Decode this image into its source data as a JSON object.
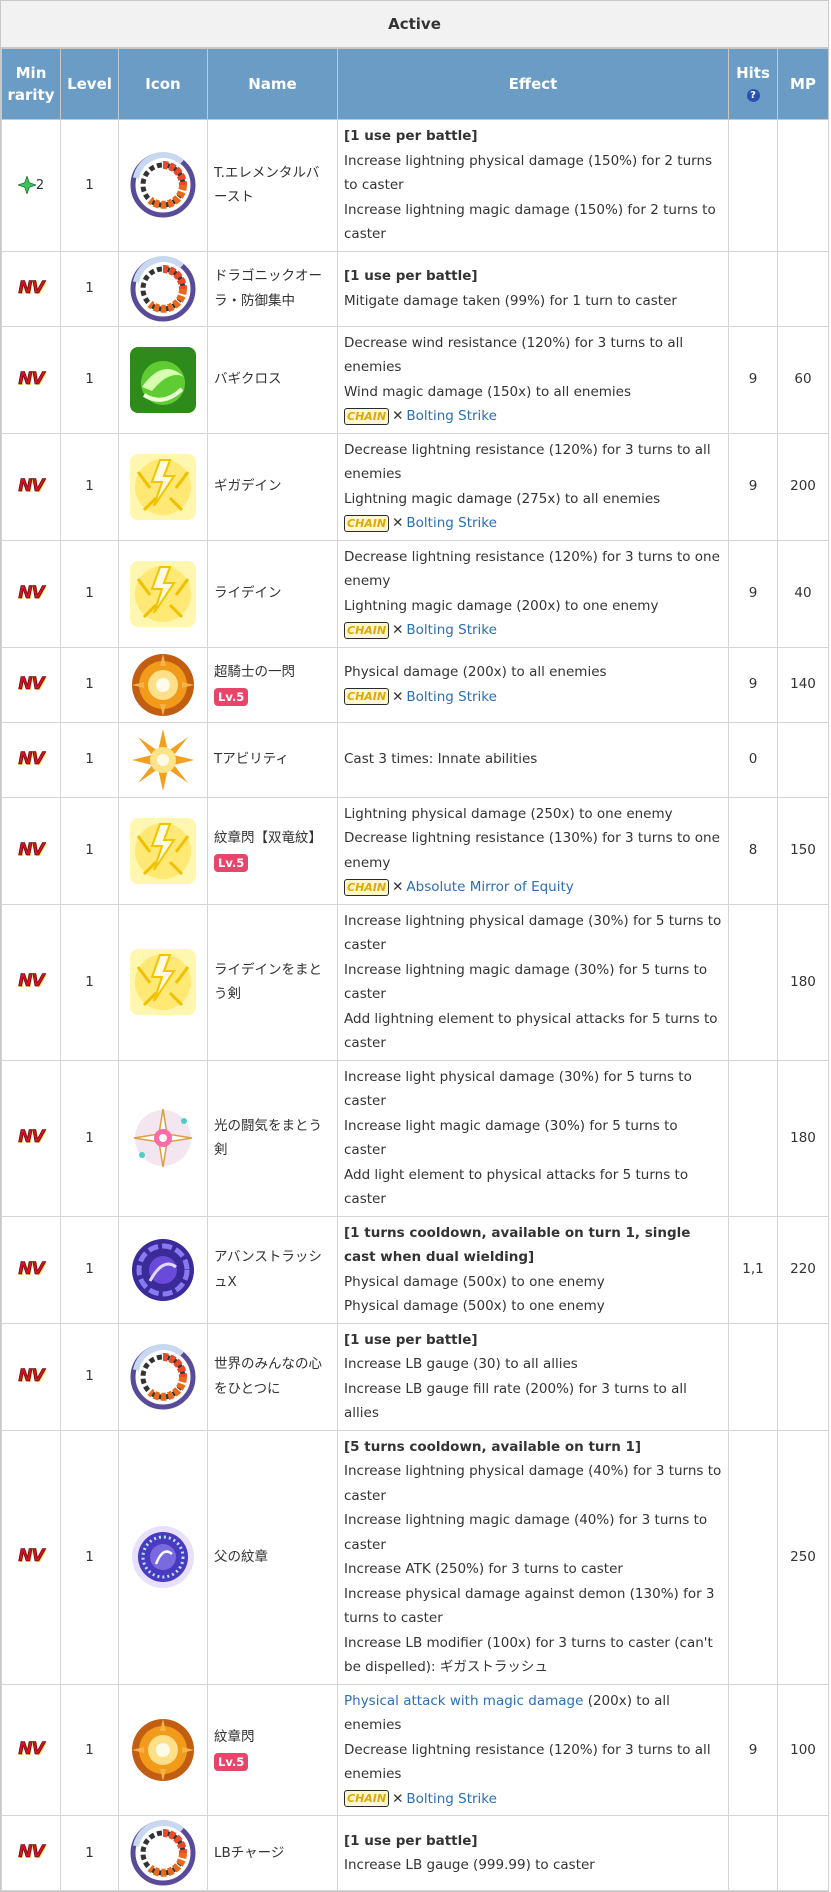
{
  "caption": "Active",
  "headers": {
    "min_rarity": "Min rarity",
    "level": "Level",
    "icon": "Icon",
    "name": "Name",
    "effect": "Effect",
    "hits": "Hits",
    "hits_help": "?",
    "mp": "MP"
  },
  "chain_label": "CHAIN",
  "chain_sep": "✕",
  "rows": [
    {
      "rarity": "2",
      "rarity_type": "star",
      "level": "1",
      "icon": "gauge-icon",
      "name": "T.エレメンタルバースト",
      "lv": "",
      "effects": [
        {
          "text": "[1 use per battle]",
          "bold": true
        },
        {
          "text": "Increase lightning physical damage (150%) for 2 turns to caster"
        },
        {
          "text": "Increase lightning magic damage (150%) for 2 turns to caster"
        }
      ],
      "chain": "",
      "hits": "",
      "mp": ""
    },
    {
      "rarity": "NV",
      "rarity_type": "nv",
      "level": "1",
      "icon": "gauge-icon",
      "name": "ドラゴニックオーラ・防御集中",
      "lv": "",
      "effects": [
        {
          "text": "[1 use per battle]",
          "bold": true
        },
        {
          "text": "Mitigate damage taken (99%) for 1 turn to caster"
        }
      ],
      "chain": "",
      "hits": "",
      "mp": ""
    },
    {
      "rarity": "NV",
      "rarity_type": "nv",
      "level": "1",
      "icon": "wind-swirl-icon",
      "name": "バギクロス",
      "lv": "",
      "effects": [
        {
          "text": "Decrease wind resistance (120%) for 3 turns to all enemies"
        },
        {
          "text": "Wind magic damage (150x) to all enemies"
        }
      ],
      "chain": "Bolting Strike",
      "hits": "9",
      "mp": "60"
    },
    {
      "rarity": "NV",
      "rarity_type": "nv",
      "level": "1",
      "icon": "lightning-icon",
      "name": "ギガデイン",
      "lv": "",
      "effects": [
        {
          "text": "Decrease lightning resistance (120%) for 3 turns to all enemies"
        },
        {
          "text": "Lightning magic damage (275x) to all enemies"
        }
      ],
      "chain": "Bolting Strike",
      "hits": "9",
      "mp": "200"
    },
    {
      "rarity": "NV",
      "rarity_type": "nv",
      "level": "1",
      "icon": "lightning-icon",
      "name": "ライデイン",
      "lv": "",
      "effects": [
        {
          "text": "Decrease lightning resistance (120%) for 3 turns to one enemy"
        },
        {
          "text": "Lightning magic damage (200x) to one enemy"
        }
      ],
      "chain": "Bolting Strike",
      "hits": "9",
      "mp": "40"
    },
    {
      "rarity": "NV",
      "rarity_type": "nv",
      "level": "1",
      "icon": "explosion-icon",
      "name": "超騎士の一閃",
      "lv": "Lv.5",
      "effects": [
        {
          "text": "Physical damage (200x) to all enemies"
        }
      ],
      "chain": "Bolting Strike",
      "hits": "9",
      "mp": "140"
    },
    {
      "rarity": "NV",
      "rarity_type": "nv",
      "level": "1",
      "icon": "burst-icon",
      "name": "Tアビリティ",
      "lv": "",
      "effects": [
        {
          "text": "Cast 3 times: Innate abilities"
        }
      ],
      "chain": "",
      "hits": "0",
      "mp": ""
    },
    {
      "rarity": "NV",
      "rarity_type": "nv",
      "level": "1",
      "icon": "lightning-icon",
      "name": "紋章閃【双竜紋】",
      "lv": "Lv.5",
      "effects": [
        {
          "text": "Lightning physical damage (250x) to one enemy"
        },
        {
          "text": "Decrease lightning resistance (130%) for 3 turns to one enemy"
        }
      ],
      "chain": "Absolute Mirror of Equity",
      "hits": "8",
      "mp": "150"
    },
    {
      "rarity": "NV",
      "rarity_type": "nv",
      "level": "1",
      "icon": "lightning-icon",
      "name": "ライデインをまとう剣",
      "lv": "",
      "effects": [
        {
          "text": "Increase lightning physical damage (30%) for 5 turns to caster"
        },
        {
          "text": "Increase lightning magic damage (30%) for 5 turns to caster"
        },
        {
          "text": "Add lightning element to physical attacks for 5 turns to caster"
        }
      ],
      "chain": "",
      "hits": "",
      "mp": "180"
    },
    {
      "rarity": "NV",
      "rarity_type": "nv",
      "level": "1",
      "icon": "light-sparkle-icon",
      "name": "光の闘気をまとう剣",
      "lv": "",
      "effects": [
        {
          "text": "Increase light physical damage (30%) for 5 turns to caster"
        },
        {
          "text": "Increase light magic damage (30%) for 5 turns to caster"
        },
        {
          "text": "Add light element to physical attacks for 5 turns to caster"
        }
      ],
      "chain": "",
      "hits": "",
      "mp": "180"
    },
    {
      "rarity": "NV",
      "rarity_type": "nv",
      "level": "1",
      "icon": "purple-vortex-icon",
      "name": "アバンストラッシュX",
      "lv": "",
      "effects": [
        {
          "text": "[1 turns cooldown, available on turn 1, single cast when dual wielding]",
          "bold": true
        },
        {
          "text": "Physical damage (500x) to one enemy"
        },
        {
          "text": "Physical damage (500x) to one enemy"
        }
      ],
      "chain": "",
      "hits": "1,1",
      "mp": "220"
    },
    {
      "rarity": "NV",
      "rarity_type": "nv",
      "level": "1",
      "icon": "gauge-icon",
      "name": "世界のみんなの心をひとつに",
      "lv": "",
      "effects": [
        {
          "text": "[1 use per battle]",
          "bold": true
        },
        {
          "text": "Increase LB gauge (30) to all allies"
        },
        {
          "text": "Increase LB gauge fill rate (200%) for 3 turns to all allies"
        }
      ],
      "chain": "",
      "hits": "",
      "mp": ""
    },
    {
      "rarity": "NV",
      "rarity_type": "nv",
      "level": "1",
      "icon": "purple-ring-icon",
      "name": "父の紋章",
      "lv": "",
      "effects": [
        {
          "text": "[5 turns cooldown, available on turn 1]",
          "bold": true
        },
        {
          "text": "Increase lightning physical damage (40%) for 3 turns to caster"
        },
        {
          "text": "Increase lightning magic damage (40%) for 3 turns to caster"
        },
        {
          "text": "Increase ATK (250%) for 3 turns to caster"
        },
        {
          "text": "Increase physical damage against demon (130%) for 3 turns to caster"
        },
        {
          "text": "Increase LB modifier (100x) for 3 turns to caster (can't be dispelled): ギガストラッシュ"
        }
      ],
      "chain": "",
      "hits": "",
      "mp": "250"
    },
    {
      "rarity": "NV",
      "rarity_type": "nv",
      "level": "1",
      "icon": "explosion-icon",
      "name": "紋章閃",
      "lv": "Lv.5",
      "effects": [
        {
          "text": "Physical attack with magic damage",
          "link": true,
          "suffix": " (200x) to all enemies"
        },
        {
          "text": "Decrease lightning resistance (120%) for 3 turns to all enemies"
        }
      ],
      "chain": "Bolting Strike",
      "hits": "9",
      "mp": "100"
    },
    {
      "rarity": "NV",
      "rarity_type": "nv",
      "level": "1",
      "icon": "gauge-icon",
      "name": "LBチャージ",
      "lv": "",
      "effects": [
        {
          "text": "[1 use per battle]",
          "bold": true
        },
        {
          "text": "Increase LB gauge (999.99) to caster"
        }
      ],
      "chain": "",
      "hits": "",
      "mp": ""
    }
  ]
}
